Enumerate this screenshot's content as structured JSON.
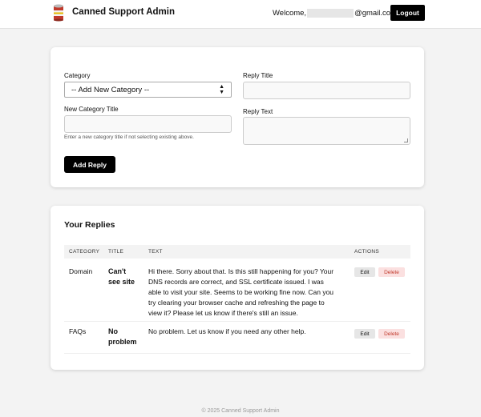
{
  "header": {
    "app_title": "Canned Support Admin",
    "welcome_prefix": "Welcome,",
    "email_suffix": "@gmail.com",
    "logout_label": "Logout",
    "logo_icon": "soup-can-icon"
  },
  "form": {
    "category_label": "Category",
    "category_selected": "-- Add New Category --",
    "new_category_label": "New Category Title",
    "new_category_value": "",
    "new_category_hint": "Enter a new category title if not selecting existing above.",
    "reply_title_label": "Reply Title",
    "reply_title_value": "",
    "reply_text_label": "Reply Text",
    "reply_text_value": "",
    "add_button_label": "Add Reply"
  },
  "replies": {
    "section_title": "Your Replies",
    "columns": [
      "CATEGORY",
      "TITLE",
      "TEXT",
      "ACTIONS"
    ],
    "rows": [
      {
        "category": "Domain",
        "title_line1": "Can't",
        "title_line2": "see site",
        "text_lines": [
          "Hi there. Sorry about that. Is this still happening for you? Your",
          "DNS records are correct, and SSL certificate issued. I was",
          "able to visit your site. Seems to be working fine now. Can you",
          "try clearing your browser cache and refreshing the page to",
          "view it? Please let us know if there's still an issue."
        ],
        "edit_label": "Edit",
        "delete_label": "Delete"
      },
      {
        "category": "FAQs",
        "title_line1": "No",
        "title_line2": "problem",
        "text_lines": [
          "No problem. Let us know if you need any other help."
        ],
        "edit_label": "Edit",
        "delete_label": "Delete"
      }
    ]
  },
  "footer": {
    "text": "© 2025 Canned Support Admin"
  },
  "colors": {
    "primary": "#000000",
    "delete_bg": "#fbe0e0",
    "delete_text": "#c0392b",
    "page_bg": "#f3f3f3"
  }
}
